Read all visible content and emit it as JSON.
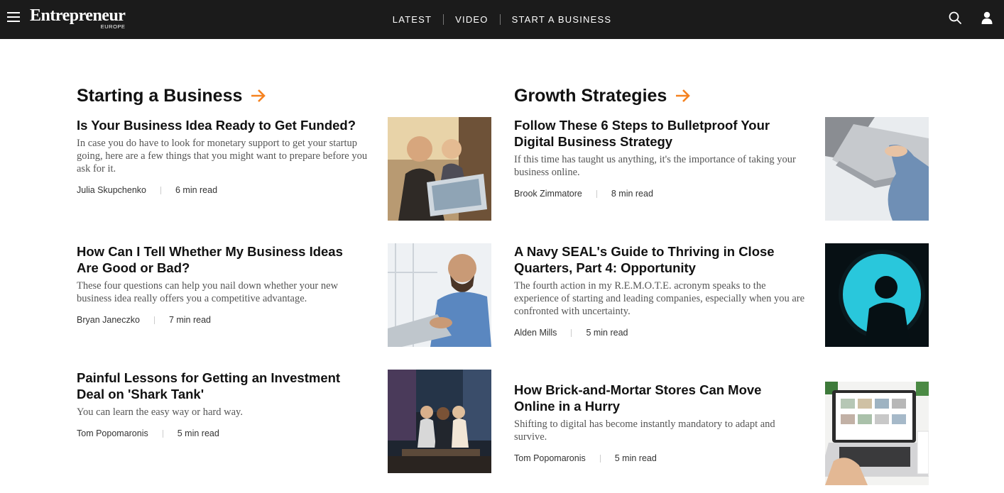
{
  "header": {
    "logo_name": "Entrepreneur",
    "logo_edition": "EUROPE",
    "nav": [
      "LATEST",
      "VIDEO",
      "START A BUSINESS"
    ]
  },
  "colors": {
    "topbar": "#1b1b1b",
    "accent": "#f58220"
  },
  "icons": [
    "hamburger-menu-icon",
    "search-icon",
    "user-icon",
    "arrow-right-icon"
  ],
  "sections": [
    {
      "title": "Starting a Business",
      "articles": [
        {
          "headline": "Is Your Business Idea Ready to Get Funded?",
          "summary": "In case you do have to look for monetary support to get your startup going, here are a few things that you might want to prepare before you ask for it.",
          "author": "Julia Skupchenko",
          "read_time": "6 min read"
        },
        {
          "headline": "How Can I Tell Whether My Business Ideas Are Good or Bad?",
          "summary": "These four questions can help you nail down whether your new business idea really offers you a competitive advantage.",
          "author": "Bryan Janeczko",
          "read_time": "7 min read"
        },
        {
          "headline": "Painful Lessons for Getting an Investment Deal on 'Shark Tank'",
          "summary": "You can learn the easy way or hard way.",
          "author": "Tom Popomaronis",
          "read_time": "5 min read"
        }
      ]
    },
    {
      "title": "Growth Strategies",
      "articles": [
        {
          "headline": "Follow These 6 Steps to Bulletproof Your Digital Business Strategy",
          "summary": "If this time has taught us anything, it's the importance of taking your business online.",
          "author": "Brook Zimmatore",
          "read_time": "8 min read"
        },
        {
          "headline": "A Navy SEAL's Guide to Thriving in Close Quarters, Part 4: Opportunity",
          "summary": "The fourth action in my R.E.M.O.T.E. acronym speaks to the experience of starting and leading companies, especially when you are confronted with uncertainty.",
          "author": "Alden Mills",
          "read_time": "5 min read"
        },
        {
          "headline": "How Brick-and-Mortar Stores Can Move Online in a Hurry",
          "summary": "Shifting to digital has become instantly mandatory to adapt and survive.",
          "author": "Tom Popomaronis",
          "read_time": "5 min read"
        }
      ]
    }
  ]
}
